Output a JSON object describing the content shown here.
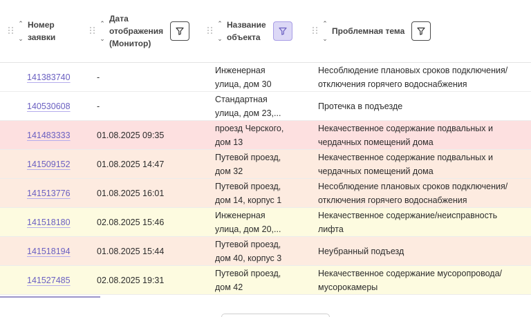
{
  "columns": [
    {
      "id": "number",
      "label": "Номер\nзаявки",
      "filter": false
    },
    {
      "id": "date",
      "label": "Дата\nотображения\n(Монитор)",
      "filter": true,
      "filter_active": false
    },
    {
      "id": "object",
      "label": "Название\nобъекта",
      "filter": true,
      "filter_active": true
    },
    {
      "id": "topic",
      "label": "Проблемная тема",
      "filter": true,
      "filter_active": false
    }
  ],
  "rows": [
    {
      "number": "141383740",
      "date": "-",
      "object": "Инженерная\nулица, дом 30",
      "topic": "Несоблюдение плановых сроков подключения/\nотключения горячего водоснабжения",
      "color": "#ffffff"
    },
    {
      "number": "140530608",
      "date": "-",
      "object": "Стандартная\nулица, дом 23,...",
      "topic": "Протечка в подъезде",
      "color": "#ffffff"
    },
    {
      "number": "141483333",
      "date": "01.08.2025 09:35",
      "object": "проезд Черского,\nдом 13",
      "topic": "Некачественное содержание подвальных и\nчердачных помещений дома",
      "color": "#fde0e0"
    },
    {
      "number": "141509152",
      "date": "01.08.2025 14:47",
      "object": "Путевой проезд,\nдом 32",
      "topic": "Некачественное содержание подвальных и\nчердачных помещений дома",
      "color": "#fdebe0"
    },
    {
      "number": "141513776",
      "date": "01.08.2025 16:01",
      "object": "Путевой проезд,\nдом 14, корпус 1",
      "topic": "Несоблюдение плановых сроков подключения/\nотключения горячего водоснабжения",
      "color": "#fdebe0"
    },
    {
      "number": "141518180",
      "date": "02.08.2025 15:46",
      "object": "Инженерная\nулица, дом 20,...",
      "topic": "Некачественное содержание/неисправность\nлифта",
      "color": "#fdfbe0"
    },
    {
      "number": "141518194",
      "date": "01.08.2025 15:44",
      "object": "Путевой проезд,\nдом 40, корпус 3",
      "topic": "Неубранный подъезд",
      "color": "#fdebe0"
    },
    {
      "number": "141527485",
      "date": "02.08.2025 19:31",
      "object": "Путевой проезд,\nдом 42",
      "topic": "Некачественное содержание мусоропровода/\nмусорокамеры",
      "color": "#fdfbe0"
    }
  ]
}
